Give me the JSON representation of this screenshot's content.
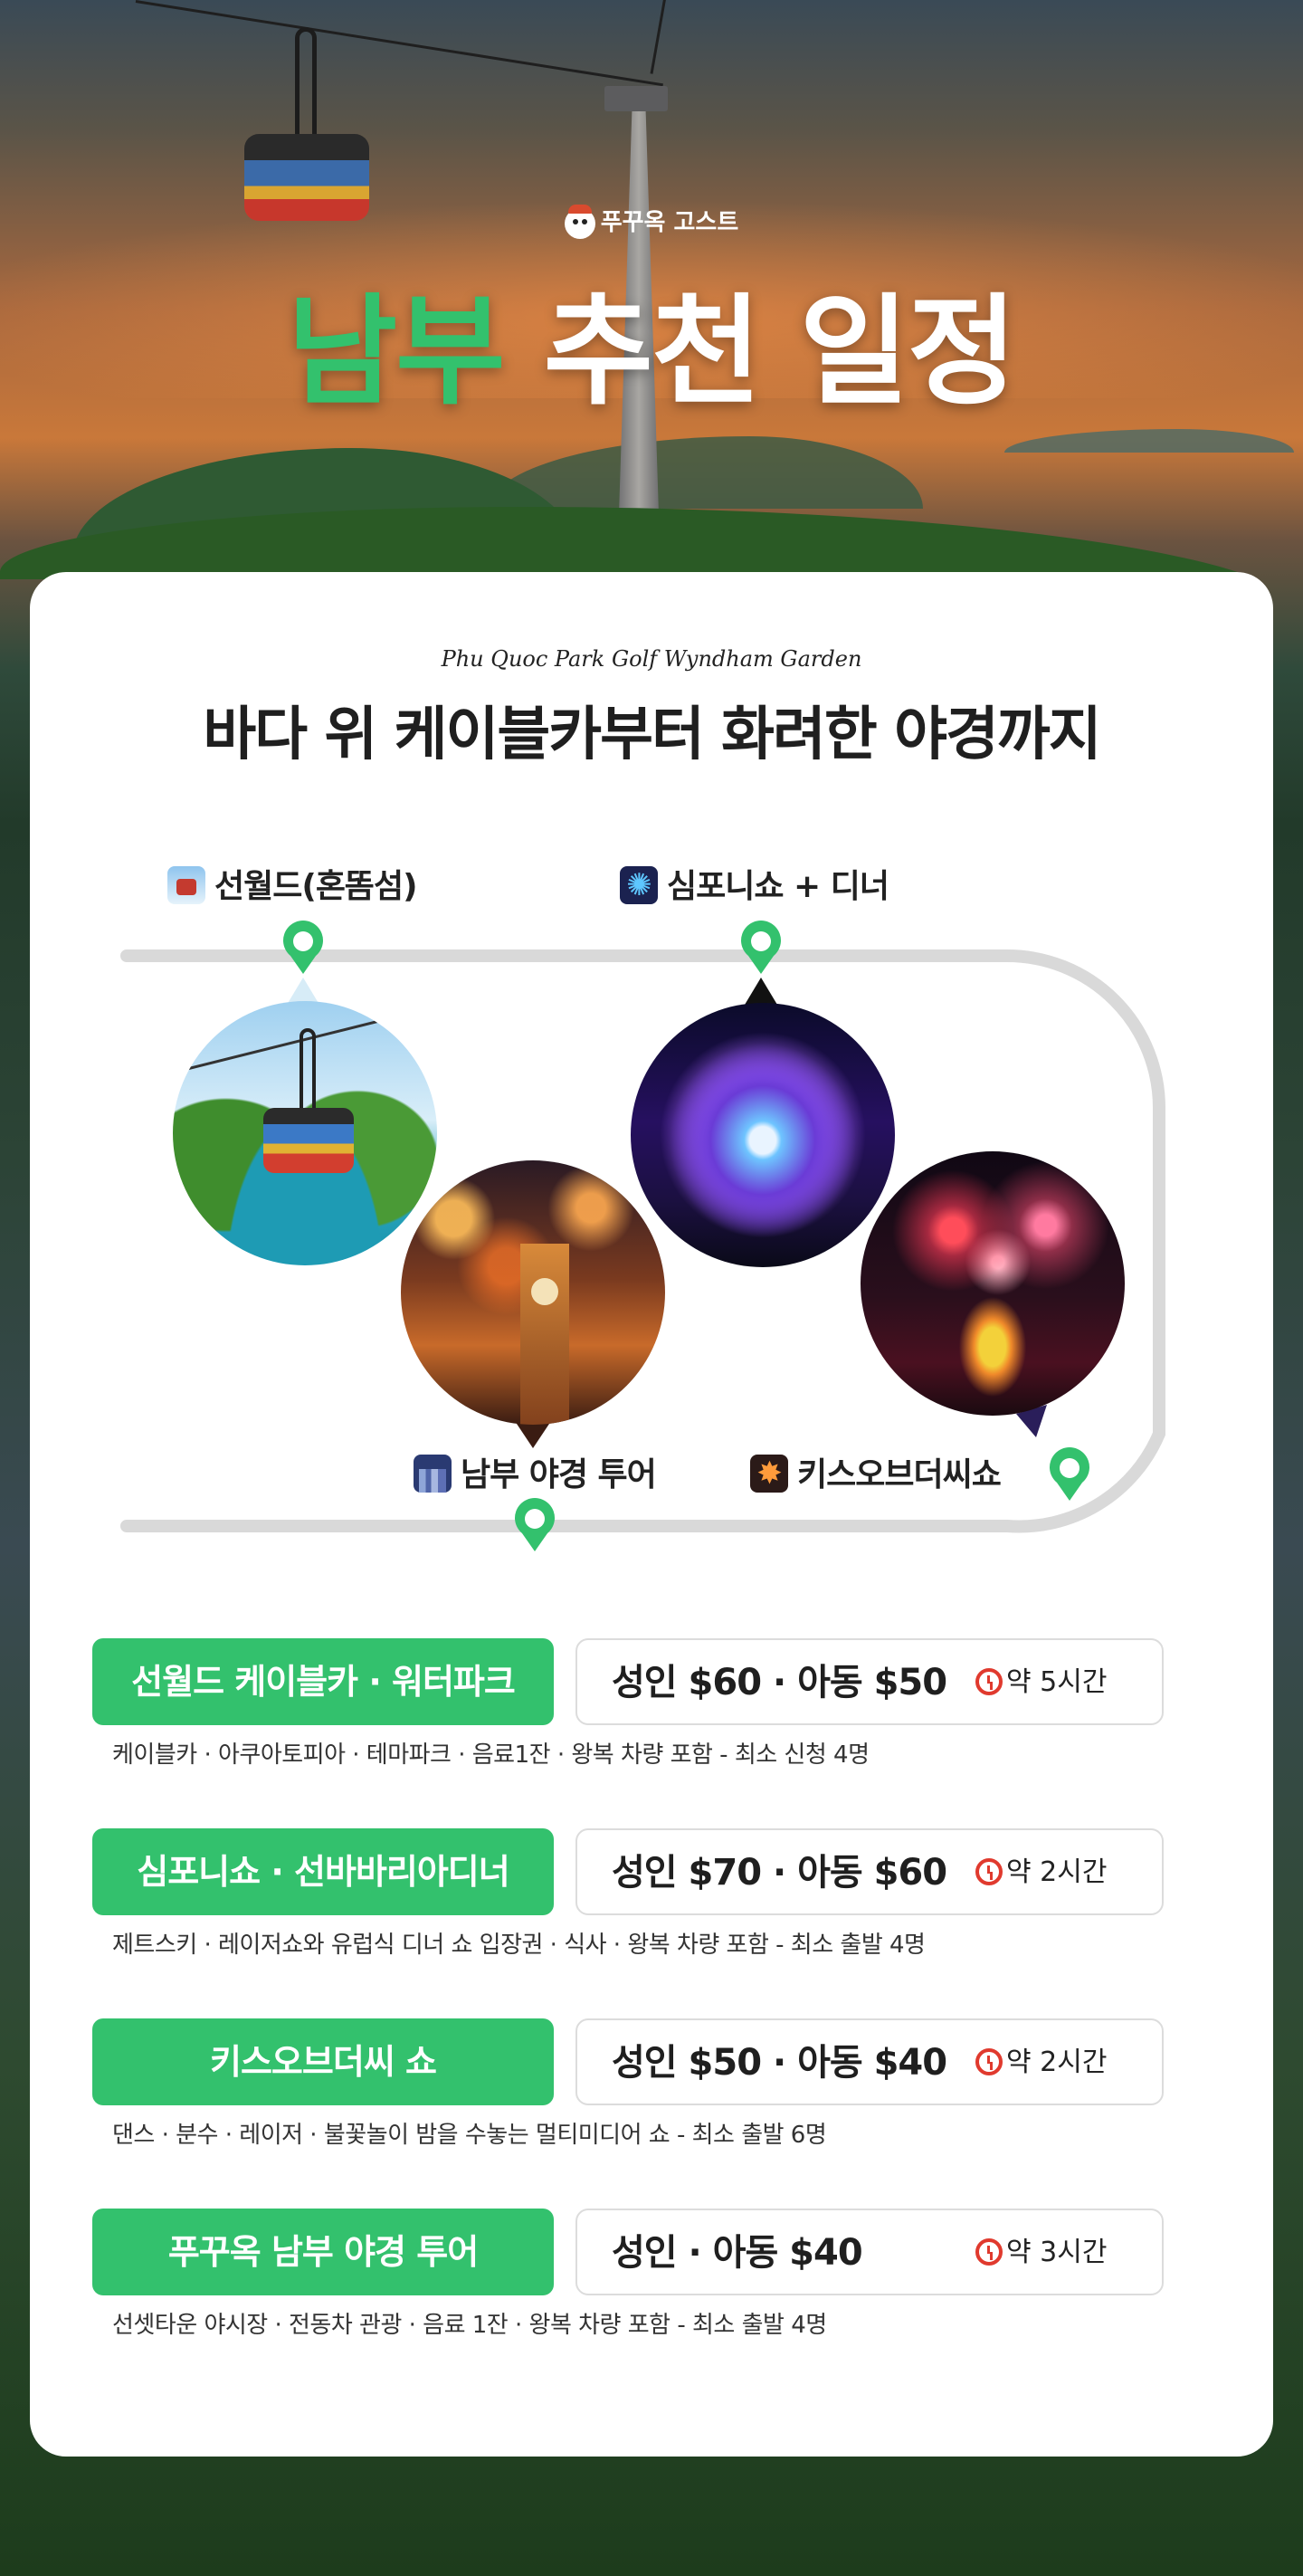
{
  "brand": {
    "name": "푸꾸옥 고스트",
    "icon": "ghost-logo-icon"
  },
  "headline": {
    "highlight": "남부",
    "rest": "추천 일정"
  },
  "card": {
    "subtitle_en": "Phu Quoc Park Golf Wyndham Garden",
    "title": "바다 위 케이블카부터 화려한 야경까지"
  },
  "route": {
    "stops": [
      {
        "label": "선월드(혼똠섬)",
        "icon": "cable-car-icon"
      },
      {
        "label": "심포니쇼 + 디너",
        "icon": "fireworks-icon"
      },
      {
        "label": "남부 야경 투어",
        "icon": "night-city-icon"
      },
      {
        "label": "키스오브더씨쇼",
        "icon": "sparkler-icon"
      }
    ]
  },
  "tours": [
    {
      "name": "선월드 케이블카 · 워터파크",
      "price": "성인 $60 · 아동 $50",
      "duration": "약 5시간",
      "desc": "케이블카 · 아쿠아토피아 · 테마파크 · 음료1잔 · 왕복 차량 포함 - 최소 신청 4명"
    },
    {
      "name": "심포니쇼 · 선바바리아디너",
      "price": "성인 $70 · 아동 $60",
      "duration": "약 2시간",
      "desc": "제트스키 · 레이저쇼와 유럽식 디너 쇼 입장권 · 식사 · 왕복 차량 포함 - 최소 출발 4명"
    },
    {
      "name": "키스오브더씨 쇼",
      "price": "성인 $50 · 아동 $40",
      "duration": "약 2시간",
      "desc": "댄스 · 분수 · 레이저 · 불꽃놀이 밤을 수놓는 멀티미디어 쇼 - 최소 출발 6명"
    },
    {
      "name": "푸꾸옥 남부 야경 투어",
      "price": "성인 · 아동 $40",
      "duration": "약 3시간",
      "desc": "선셋타운 야시장 · 전동차 관광 · 음료 1잔 · 왕복 차량 포함 - 최소 출발 4명"
    }
  ],
  "colors": {
    "accent": "#33c16d",
    "track": "#d9d9d9",
    "text": "#1f1f1f"
  }
}
